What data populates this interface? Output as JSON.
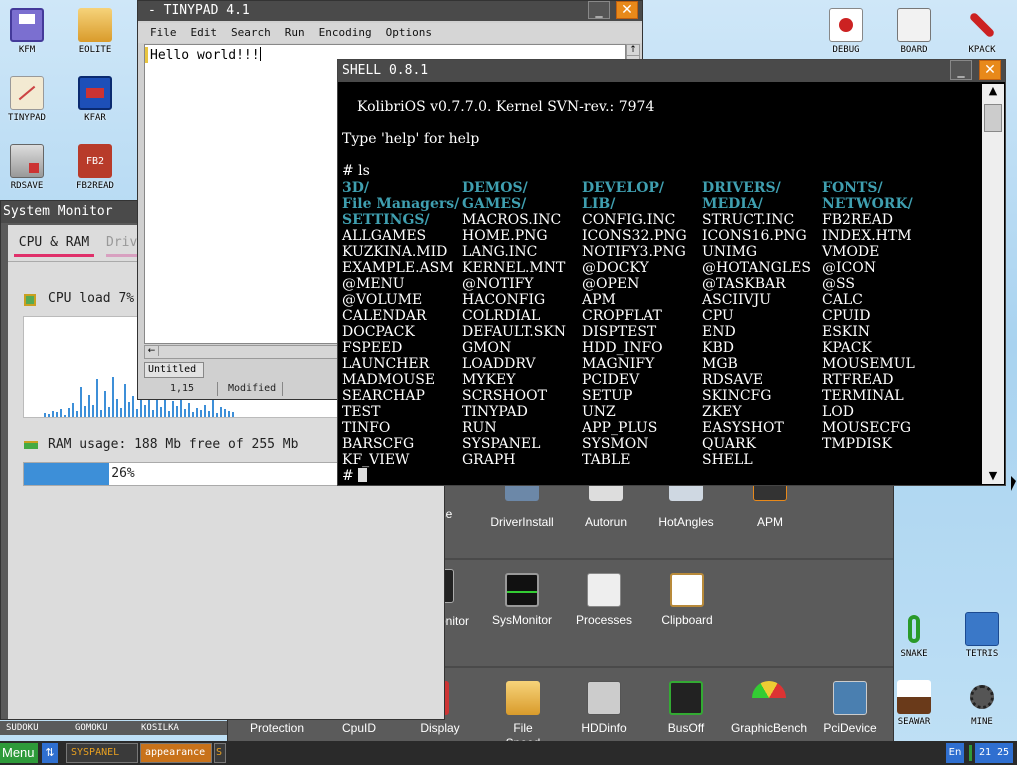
{
  "desktop": {
    "icons_left": [
      {
        "label": "KFM",
        "icon": "floppy-icon"
      },
      {
        "label": "EOLITE",
        "icon": "folder-icon"
      },
      {
        "label": "TINYPAD",
        "icon": "notepad-icon"
      },
      {
        "label": "KFAR",
        "icon": "kfar-icon"
      },
      {
        "label": "RDSAVE",
        "icon": "ramdisk-save-icon"
      },
      {
        "label": "FB2READ",
        "icon": "book-icon"
      }
    ],
    "icons_right_top": [
      {
        "label": "DEBUG",
        "icon": "bug-icon"
      },
      {
        "label": "BOARD",
        "icon": "board-icon"
      },
      {
        "label": "KPACK",
        "icon": "wrench-icon"
      }
    ],
    "icons_right_bottom": [
      {
        "label": "SNAKE",
        "icon": "snake-icon"
      },
      {
        "label": "TETRIS",
        "icon": "tetris-icon"
      },
      {
        "label": "SEAWAR",
        "icon": "ship-icon"
      },
      {
        "label": "MINE",
        "icon": "mine-icon"
      }
    ],
    "icons_bottom_left": [
      {
        "label": "SUDOKU"
      },
      {
        "label": "GOMOKU"
      },
      {
        "label": "KOSILKA"
      }
    ]
  },
  "tinypad": {
    "title": "- TINYPAD 4.1",
    "menu": [
      "File",
      "Edit",
      "Search",
      "Run",
      "Encoding",
      "Options"
    ],
    "text": "Hello world!!!",
    "tab": "Untitled",
    "status_pos": "1,15",
    "status_mod": "Modified"
  },
  "sysmon": {
    "title": "System Monitor",
    "tabs": [
      "CPU & RAM",
      "Driv"
    ],
    "cpu_label": "CPU load 7%",
    "cpu_bars": [
      4,
      3,
      6,
      5,
      8,
      2,
      9,
      14,
      6,
      30,
      11,
      22,
      12,
      38,
      7,
      26,
      10,
      40,
      18,
      9,
      33,
      15,
      21,
      8,
      36,
      12,
      19,
      7,
      24,
      10,
      29,
      6,
      16,
      11,
      20,
      8,
      14,
      5,
      9,
      7,
      12,
      6,
      18,
      4,
      10,
      8,
      6,
      5
    ],
    "ram_label": "RAM usage: 188 Mb free of 255 Mb",
    "ram_percent": "26%",
    "ram_fraction": 0.26
  },
  "shell": {
    "title": "SHELL 0.8.1",
    "line1": "KolibriOS v0.7.7.0. Kernel SVN-rev.: 7974",
    "line2": "Type 'help' for help",
    "line3": "# ls",
    "prompt": "#",
    "ls": [
      {
        "t": "3D/",
        "d": true
      },
      {
        "t": "DEMOS/",
        "d": true
      },
      {
        "t": "DEVELOP/",
        "d": true
      },
      {
        "t": "DRIVERS/",
        "d": true
      },
      {
        "t": "FONTS/",
        "d": true
      },
      {
        "t": "File Managers/",
        "d": true
      },
      {
        "t": "GAMES/",
        "d": true
      },
      {
        "t": "LIB/",
        "d": true
      },
      {
        "t": "MEDIA/",
        "d": true
      },
      {
        "t": "NETWORK/",
        "d": true
      },
      {
        "t": "SETTINGS/",
        "d": true
      },
      {
        "t": "MACROS.INC"
      },
      {
        "t": "CONFIG.INC"
      },
      {
        "t": "STRUCT.INC"
      },
      {
        "t": "FB2READ"
      },
      {
        "t": "ALLGAMES"
      },
      {
        "t": "HOME.PNG"
      },
      {
        "t": "ICONS32.PNG"
      },
      {
        "t": "ICONS16.PNG"
      },
      {
        "t": "INDEX.HTM"
      },
      {
        "t": "KUZKINA.MID"
      },
      {
        "t": "LANG.INC"
      },
      {
        "t": "NOTIFY3.PNG"
      },
      {
        "t": "UNIMG"
      },
      {
        "t": "VMODE"
      },
      {
        "t": "EXAMPLE.ASM"
      },
      {
        "t": "KERNEL.MNT"
      },
      {
        "t": "@DOCKY"
      },
      {
        "t": "@HOTANGLES"
      },
      {
        "t": "@ICON"
      },
      {
        "t": "@MENU"
      },
      {
        "t": "@NOTIFY"
      },
      {
        "t": "@OPEN"
      },
      {
        "t": "@TASKBAR"
      },
      {
        "t": "@SS"
      },
      {
        "t": "@VOLUME"
      },
      {
        "t": "HACONFIG"
      },
      {
        "t": "APM"
      },
      {
        "t": "ASCIIVJU"
      },
      {
        "t": "CALC"
      },
      {
        "t": "CALENDAR"
      },
      {
        "t": "COLRDIAL"
      },
      {
        "t": "CROPFLAT"
      },
      {
        "t": "CPU"
      },
      {
        "t": "CPUID"
      },
      {
        "t": "DOCPACK"
      },
      {
        "t": "DEFAULT.SKN"
      },
      {
        "t": "DISPTEST"
      },
      {
        "t": "END"
      },
      {
        "t": "ESKIN"
      },
      {
        "t": "FSPEED"
      },
      {
        "t": "GMON"
      },
      {
        "t": "HDD_INFO"
      },
      {
        "t": "KBD"
      },
      {
        "t": "KPACK"
      },
      {
        "t": "LAUNCHER"
      },
      {
        "t": "LOADDRV"
      },
      {
        "t": "MAGNIFY"
      },
      {
        "t": "MGB"
      },
      {
        "t": "MOUSEMUL"
      },
      {
        "t": "MADMOUSE"
      },
      {
        "t": "MYKEY"
      },
      {
        "t": "PCIDEV"
      },
      {
        "t": "RDSAVE"
      },
      {
        "t": "RTFREAD"
      },
      {
        "t": "SEARCHAP"
      },
      {
        "t": "SCRSHOOT"
      },
      {
        "t": "SETUP"
      },
      {
        "t": "SKINCFG"
      },
      {
        "t": "TERMINAL"
      },
      {
        "t": "TEST"
      },
      {
        "t": "TINYPAD"
      },
      {
        "t": "UNZ"
      },
      {
        "t": "ZKEY"
      },
      {
        "t": "LOD"
      },
      {
        "t": "TINFO"
      },
      {
        "t": "RUN"
      },
      {
        "t": "APP_PLUS"
      },
      {
        "t": "EASYSHOT"
      },
      {
        "t": "MOUSECFG"
      },
      {
        "t": "BARSCFG"
      },
      {
        "t": "SYSPANEL"
      },
      {
        "t": "SYSMON"
      },
      {
        "t": "QUARK"
      },
      {
        "t": "TMPDISK"
      },
      {
        "t": "KF_VIEW"
      },
      {
        "t": "GRAPH"
      },
      {
        "t": "TABLE"
      },
      {
        "t": "SHELL"
      }
    ]
  },
  "panel": {
    "row1": [
      "se",
      "DriverInstall",
      "Autorun",
      "HotAngles",
      "APM"
    ],
    "row2": [
      "onitor",
      "SysMonitor",
      "Processes",
      "Clipboard"
    ],
    "row3": [
      "Protection",
      "CpuID",
      "Display",
      "File Speed",
      "HDDinfo",
      "BusOff",
      "GraphicBench",
      "PciDevice"
    ]
  },
  "taskbar": {
    "menu": "Menu",
    "items": [
      "SYSPANEL",
      "appearance",
      "S"
    ],
    "lang": "En",
    "time": "21 25"
  }
}
